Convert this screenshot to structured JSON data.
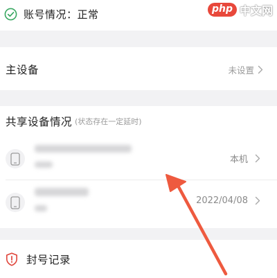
{
  "account_status": {
    "label": "账号情况：正常",
    "icon": "check-circle-icon",
    "color": "#3aa862"
  },
  "main_device": {
    "title": "主设备",
    "value": "未设置"
  },
  "shared_devices": {
    "title": "共享设备情况",
    "note": "(状态存在一定延时)",
    "items": [
      {
        "right_text": "本机"
      },
      {
        "right_text": "2022/04/08"
      }
    ]
  },
  "ban_record": {
    "title": "封号记录",
    "icon": "shield-alert-icon",
    "color": "#e0443a"
  },
  "watermark": {
    "badge": "php",
    "text": "中文网"
  },
  "annotation": {
    "arrow_color": "#ee5a3f"
  }
}
